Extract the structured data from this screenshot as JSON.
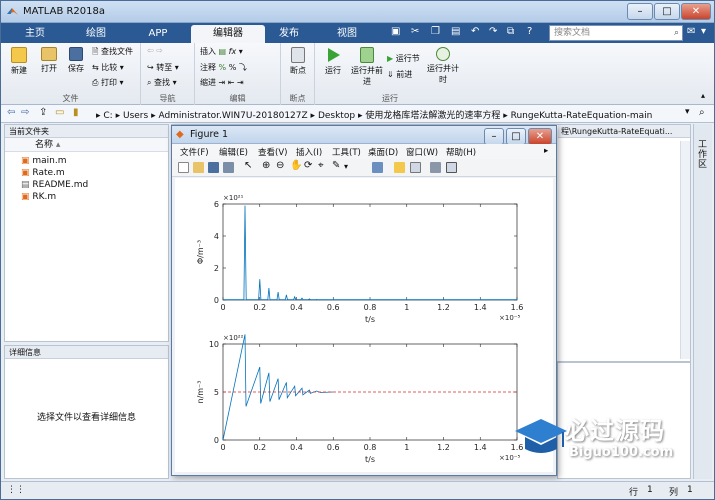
{
  "app": {
    "title": "MATLAB R2018a"
  },
  "window_controls": {
    "minimize": "–",
    "maximize": "□",
    "close": "✕"
  },
  "tabs": [
    {
      "label": "主页"
    },
    {
      "label": "绘图"
    },
    {
      "label": "APP"
    },
    {
      "label": "编辑器"
    },
    {
      "label": "发布"
    },
    {
      "label": "视图"
    }
  ],
  "search": {
    "placeholder": "搜索文档"
  },
  "ribbon": {
    "groups": {
      "file": "文件",
      "nav": "导航",
      "edit": "编辑",
      "breakpoints": "断点",
      "run": "运行"
    },
    "buttons": {
      "new": "新建",
      "open": "打开",
      "save": "保存",
      "find_files": "查找文件",
      "compare": "比较",
      "print": "打印",
      "goto": "转至",
      "find": "查找",
      "insert": "插入",
      "comment": "注释",
      "indent": "缩进",
      "fx": "fx",
      "breakpoints": "断点",
      "run": "运行",
      "run_advance": "运行并前进",
      "run_section": "运行节",
      "advance": "前进",
      "run_time": "运行并计时"
    }
  },
  "address": {
    "segments": [
      "C:",
      "Users",
      "Administrator.WIN7U-20180127Z",
      "Desktop",
      "使用龙格库塔法解激光的速率方程",
      "RungeKutta-RateEquation-main"
    ]
  },
  "current_folder": {
    "title": "当前文件夹",
    "col_name": "名称",
    "files": [
      {
        "name": "main.m"
      },
      {
        "name": "Rate.m"
      },
      {
        "name": "README.md"
      },
      {
        "name": "RK.m"
      }
    ]
  },
  "details": {
    "title": "详细信息",
    "hint": "选择文件以查看详细信息"
  },
  "editor_path": "程\\RungeKutta-RateEquati...",
  "right_tab": "工作区",
  "figure": {
    "title": "Figure 1",
    "menu": [
      "文件(F)",
      "编辑(E)",
      "查看(V)",
      "插入(I)",
      "工具(T)",
      "桌面(D)",
      "窗口(W)",
      "帮助(H)"
    ]
  },
  "status": {
    "row_label": "行",
    "row": "1",
    "col_label": "列",
    "col": "1"
  },
  "watermark": {
    "brand": "必过源码",
    "url": "Biguo100.com"
  },
  "chart_data": [
    {
      "type": "line",
      "title": "",
      "xlabel": "t/s",
      "ylabel": "Φ/m⁻³",
      "x_exponent": "×10⁻⁵",
      "y_exponent": "×10²¹",
      "xlim": [
        0,
        1.6
      ],
      "ylim": [
        0,
        6
      ],
      "x_ticks": [
        "0",
        "0.2",
        "0.4",
        "0.6",
        "0.8",
        "1",
        "1.2",
        "1.4",
        "1.6"
      ],
      "y_ticks": [
        "0",
        "2",
        "4",
        "6"
      ],
      "series": [
        {
          "color": "#0072bd",
          "spikes": [
            {
              "t": 0.12,
              "peak": 5.9
            },
            {
              "t": 0.2,
              "peak": 1.3
            },
            {
              "t": 0.25,
              "peak": 0.75
            },
            {
              "t": 0.3,
              "peak": 0.5
            },
            {
              "t": 0.345,
              "peak": 0.32
            },
            {
              "t": 0.39,
              "peak": 0.2
            },
            {
              "t": 0.43,
              "peak": 0.12
            },
            {
              "t": 0.47,
              "peak": 0.07
            },
            {
              "t": 0.51,
              "peak": 0.04
            }
          ],
          "baseline": 0.02
        }
      ]
    },
    {
      "type": "line",
      "title": "",
      "xlabel": "t/s",
      "ylabel": "n/m⁻³",
      "x_exponent": "×10⁻⁵",
      "y_exponent": "×10²²",
      "xlim": [
        0,
        1.6
      ],
      "ylim": [
        0,
        10
      ],
      "x_ticks": [
        "0",
        "0.2",
        "0.4",
        "0.6",
        "0.8",
        "1",
        "1.2",
        "1.4",
        "1.6"
      ],
      "y_ticks": [
        "0",
        "5",
        "10"
      ],
      "series": [
        {
          "color": "#0072bd",
          "points": [
            [
              0,
              0
            ],
            [
              0.12,
              11
            ],
            [
              0.125,
              3.5
            ],
            [
              0.2,
              7.6
            ],
            [
              0.205,
              3.8
            ],
            [
              0.25,
              7.0
            ],
            [
              0.255,
              4.0
            ],
            [
              0.3,
              6.4
            ],
            [
              0.305,
              4.2
            ],
            [
              0.345,
              6.0
            ],
            [
              0.35,
              4.4
            ],
            [
              0.39,
              5.6
            ],
            [
              0.395,
              4.6
            ],
            [
              0.43,
              5.4
            ],
            [
              0.435,
              4.7
            ],
            [
              0.47,
              5.2
            ],
            [
              0.475,
              4.85
            ],
            [
              0.51,
              5.1
            ],
            [
              0.53,
              4.95
            ],
            [
              0.6,
              5.0
            ]
          ]
        },
        {
          "color": "#d62728",
          "dashed": true,
          "points": [
            [
              0,
              5
            ],
            [
              1.6,
              5
            ]
          ]
        }
      ]
    }
  ]
}
